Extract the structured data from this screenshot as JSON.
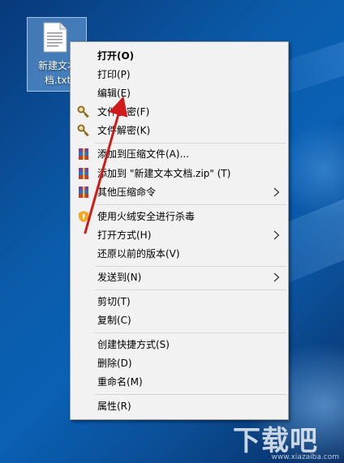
{
  "desktop": {
    "icon_label": "新建文本文档.txt",
    "icon_label_visible_line1": "新建文本",
    "icon_label_visible_line2": "档.txt"
  },
  "context_menu": {
    "items": [
      {
        "label": "打开(O)",
        "bold": true,
        "icon": ""
      },
      {
        "label": "打印(P)",
        "icon": ""
      },
      {
        "label": "编辑(E)",
        "icon": ""
      },
      {
        "label": "文件加密(F)",
        "icon": "key-icon"
      },
      {
        "label": "文件解密(K)",
        "icon": "key-icon"
      },
      {
        "label": "添加到压缩文件(A)...",
        "icon": "winrar-icon"
      },
      {
        "label": "添加到 \"新建文本文档.zip\" (T)",
        "icon": "winrar-icon"
      },
      {
        "label": "其他压缩命令",
        "icon": "winrar-icon",
        "submenu": true
      },
      {
        "label": "使用火绒安全进行杀毒",
        "icon": "shield-icon"
      },
      {
        "label": "打开方式(H)",
        "icon": "",
        "submenu": true
      },
      {
        "label": "还原以前的版本(V)",
        "icon": ""
      },
      {
        "label": "发送到(N)",
        "icon": "",
        "submenu": true
      },
      {
        "label": "剪切(T)",
        "icon": ""
      },
      {
        "label": "复制(C)",
        "icon": ""
      },
      {
        "label": "创建快捷方式(S)",
        "icon": ""
      },
      {
        "label": "删除(D)",
        "icon": ""
      },
      {
        "label": "重命名(M)",
        "icon": ""
      },
      {
        "label": "属性(R)",
        "icon": ""
      }
    ]
  },
  "watermark": {
    "text": "下载吧",
    "sub": "www.xiazaiba.com"
  },
  "colors": {
    "menu_bg": "#f2f2f2",
    "desktop_blue": "#0b5cab",
    "arrow_red": "#d11a1a"
  }
}
